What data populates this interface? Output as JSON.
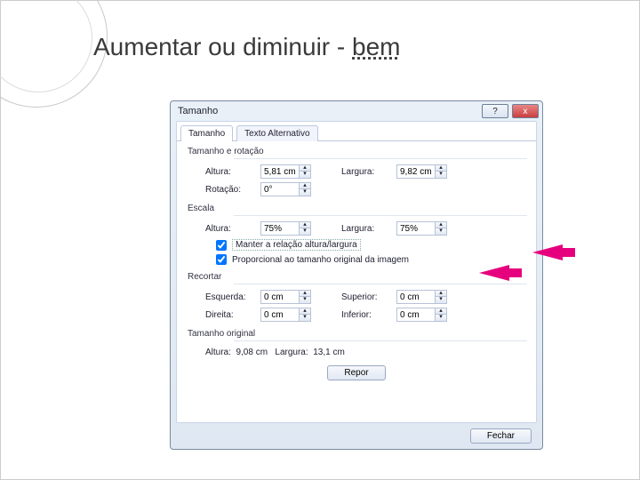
{
  "slide": {
    "title_prefix": "Aumentar ou diminuir - ",
    "title_emph": "bem"
  },
  "dialog": {
    "title": "Tamanho",
    "help": "?",
    "close": "x",
    "tabs": {
      "size": "Tamanho",
      "alt": "Texto Alternativo"
    },
    "sections": {
      "sizerot": "Tamanho e rotação",
      "escala": "Escala",
      "recortar": "Recortar",
      "orig": "Tamanho original"
    },
    "labels": {
      "altura": "Altura:",
      "largura": "Largura:",
      "rotacao": "Rotação:",
      "esquerda": "Esquerda:",
      "direita": "Direita:",
      "superior": "Superior:",
      "inferior": "Inferior:"
    },
    "values": {
      "altura_cm": "5,81 cm",
      "largura_cm": "9,82 cm",
      "rotacao": "0°",
      "escala_altura": "75%",
      "escala_largura": "75%",
      "rec_esq": "0 cm",
      "rec_dir": "0 cm",
      "rec_sup": "0 cm",
      "rec_inf": "0 cm",
      "orig_altura": "9,08 cm",
      "orig_largura": "13,1 cm"
    },
    "checks": {
      "manter": "Manter a relação altura/largura",
      "prop": "Proporcional ao tamanho original da imagem"
    },
    "buttons": {
      "repor": "Repor",
      "fechar": "Fechar"
    }
  }
}
